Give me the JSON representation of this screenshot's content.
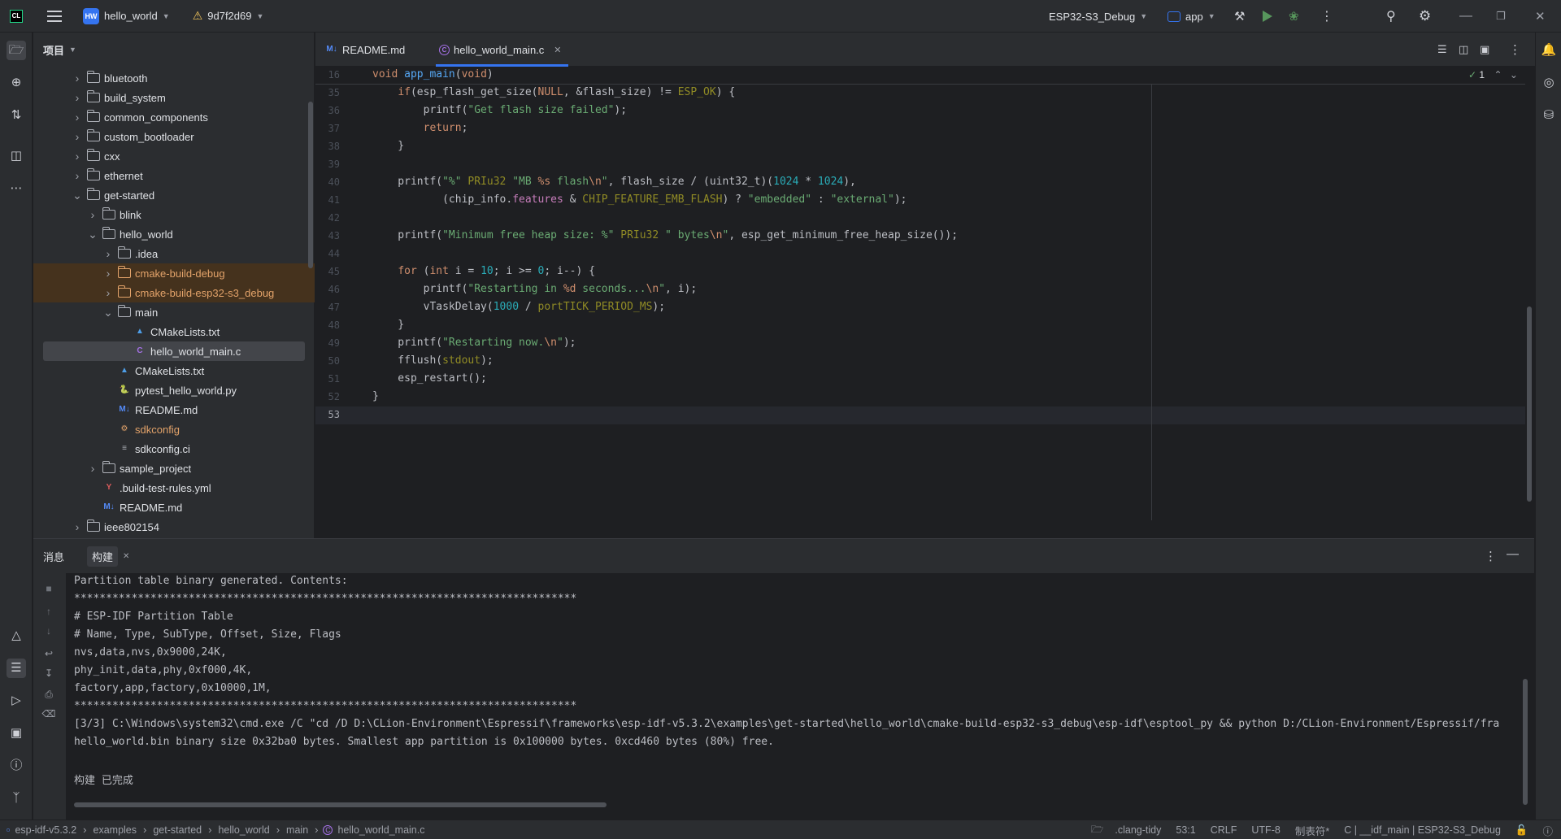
{
  "titlebar": {
    "project_badge": "HW",
    "project_name": "hello_world",
    "vcs_branch": "9d7f2d69",
    "run_config": "ESP32-S3_Debug",
    "target": "app"
  },
  "project_panel": {
    "title": "项目",
    "tree": [
      {
        "label": "bluetooth",
        "type": "folder",
        "depth": 0,
        "expanded": false,
        "excluded": false
      },
      {
        "label": "build_system",
        "type": "folder",
        "depth": 0,
        "expanded": false,
        "excluded": false
      },
      {
        "label": "common_components",
        "type": "folder",
        "depth": 0,
        "expanded": false,
        "excluded": false
      },
      {
        "label": "custom_bootloader",
        "type": "folder",
        "depth": 0,
        "expanded": false,
        "excluded": false
      },
      {
        "label": "cxx",
        "type": "folder",
        "depth": 0,
        "expanded": false,
        "excluded": false
      },
      {
        "label": "ethernet",
        "type": "folder",
        "depth": 0,
        "expanded": false,
        "excluded": false
      },
      {
        "label": "get-started",
        "type": "folder",
        "depth": 0,
        "expanded": true,
        "excluded": false
      },
      {
        "label": "blink",
        "type": "folder",
        "depth": 1,
        "expanded": false,
        "excluded": false
      },
      {
        "label": "hello_world",
        "type": "folder",
        "depth": 1,
        "expanded": true,
        "excluded": false
      },
      {
        "label": ".idea",
        "type": "folder",
        "depth": 2,
        "expanded": false,
        "excluded": false
      },
      {
        "label": "cmake-build-debug",
        "type": "folder",
        "depth": 2,
        "expanded": false,
        "excluded": true
      },
      {
        "label": "cmake-build-esp32-s3_debug",
        "type": "folder",
        "depth": 2,
        "expanded": false,
        "excluded": true
      },
      {
        "label": "main",
        "type": "folder",
        "depth": 2,
        "expanded": true,
        "excluded": false
      },
      {
        "label": "CMakeLists.txt",
        "type": "cmake",
        "depth": 3
      },
      {
        "label": "hello_world_main.c",
        "type": "c",
        "depth": 3,
        "selected": true
      },
      {
        "label": "CMakeLists.txt",
        "type": "cmake",
        "depth": 2
      },
      {
        "label": "pytest_hello_world.py",
        "type": "python",
        "depth": 2
      },
      {
        "label": "README.md",
        "type": "md",
        "depth": 2
      },
      {
        "label": "sdkconfig",
        "type": "config",
        "depth": 2
      },
      {
        "label": "sdkconfig.ci",
        "type": "text",
        "depth": 2
      },
      {
        "label": "sample_project",
        "type": "folder",
        "depth": 1,
        "expanded": false,
        "excluded": false
      },
      {
        "label": ".build-test-rules.yml",
        "type": "yaml",
        "depth": 1
      },
      {
        "label": "README.md",
        "type": "md",
        "depth": 1
      },
      {
        "label": "ieee802154",
        "type": "folder",
        "depth": 0,
        "expanded": false,
        "excluded": false
      }
    ]
  },
  "editor": {
    "tabs": [
      {
        "label": "README.md",
        "icon": "M↓",
        "active": false
      },
      {
        "label": "hello_world_main.c",
        "icon": "C",
        "active": true
      }
    ],
    "inspection_count": "1",
    "sticky_line": {
      "num": "16",
      "text": "void app_main(void)"
    },
    "lines": [
      {
        "num": "35",
        "html": "    <span class=\"kw\">if</span>(esp_flash_get_size(<span class=\"kw\">NULL</span>, &amp;flash_size) != <span class=\"mac\">ESP_OK</span>) {"
      },
      {
        "num": "36",
        "html": "        printf(<span class=\"str\">\"Get flash size failed\"</span>);"
      },
      {
        "num": "37",
        "html": "        <span class=\"kw\">return</span>;"
      },
      {
        "num": "38",
        "html": "    }"
      },
      {
        "num": "39",
        "html": ""
      },
      {
        "num": "40",
        "html": "    printf(<span class=\"str\">\"%\"</span> <span class=\"mac\">PRIu32</span> <span class=\"str\">\"MB </span><span class=\"esc\">%s</span><span class=\"str\"> flash</span><span class=\"esc\">\\n</span><span class=\"str\">\"</span>, flash_size / (uint32_t)(<span class=\"num\">1024</span> * <span class=\"num\">1024</span>),"
      },
      {
        "num": "41",
        "html": "           (chip_info.<span class=\"fld\">features</span> &amp; <span class=\"mac\">CHIP_FEATURE_EMB_FLASH</span>) ? <span class=\"str\">\"embedded\"</span> : <span class=\"str\">\"external\"</span>);"
      },
      {
        "num": "42",
        "html": ""
      },
      {
        "num": "43",
        "html": "    printf(<span class=\"str\">\"Minimum free heap size: %\"</span> <span class=\"mac\">PRIu32</span> <span class=\"str\">\" bytes</span><span class=\"esc\">\\n</span><span class=\"str\">\"</span>, esp_get_minimum_free_heap_size());"
      },
      {
        "num": "44",
        "html": ""
      },
      {
        "num": "45",
        "html": "    <span class=\"kw\">for</span> (<span class=\"kw\">int</span> i = <span class=\"num\">10</span>; i &gt;= <span class=\"num\">0</span>; i--) {"
      },
      {
        "num": "46",
        "html": "        printf(<span class=\"str\">\"Restarting in </span><span class=\"esc\">%d</span><span class=\"str\"> seconds...</span><span class=\"esc\">\\n</span><span class=\"str\">\"</span>, i);"
      },
      {
        "num": "47",
        "html": "        vTaskDelay(<span class=\"num\">1000</span> / <span class=\"mac\">portTICK_PERIOD_MS</span>);"
      },
      {
        "num": "48",
        "html": "    }"
      },
      {
        "num": "49",
        "html": "    printf(<span class=\"str\">\"Restarting now.</span><span class=\"esc\">\\n</span><span class=\"str\">\"</span>);"
      },
      {
        "num": "50",
        "html": "    fflush(<span class=\"mac\">stdout</span>);"
      },
      {
        "num": "51",
        "html": "    esp_restart();"
      },
      {
        "num": "52",
        "html": "}"
      },
      {
        "num": "53",
        "html": ""
      }
    ]
  },
  "bottom_panel": {
    "tabs": [
      {
        "label": "消息",
        "active": false
      },
      {
        "label": "构建",
        "active": true
      }
    ],
    "console_lines": [
      "Partition table binary generated. Contents:",
      "*******************************************************************************",
      "# ESP-IDF Partition Table",
      "# Name, Type, SubType, Offset, Size, Flags",
      "nvs,data,nvs,0x9000,24K,",
      "phy_init,data,phy,0xf000,4K,",
      "factory,app,factory,0x10000,1M,",
      "*******************************************************************************",
      "[3/3] C:\\Windows\\system32\\cmd.exe /C \"cd /D D:\\CLion-Environment\\Espressif\\frameworks\\esp-idf-v5.3.2\\examples\\get-started\\hello_world\\cmake-build-esp32-s3_debug\\esp-idf\\esptool_py && python D:/CLion-Environment/Espressif/fra",
      "hello_world.bin binary size 0x32ba0 bytes. Smallest app partition is 0x100000 bytes. 0xcd460 bytes (80%) free.",
      "",
      "构建 已完成"
    ]
  },
  "statusbar": {
    "breadcrumbs": [
      "esp-idf-v5.3.2",
      "examples",
      "get-started",
      "hello_world",
      "main",
      "hello_world_main.c"
    ],
    "clang_tidy": ".clang-tidy",
    "position": "53:1",
    "line_ending": "CRLF",
    "encoding": "UTF-8",
    "indent": "制表符*",
    "context": "C | __idf_main | ESP32-S3_Debug"
  },
  "colors": {
    "accent": "#3574f0",
    "excluded_bg": "#45321d",
    "excluded_fg": "#e3a36a",
    "run_green": "#57965c",
    "warning": "#f2c55c"
  }
}
